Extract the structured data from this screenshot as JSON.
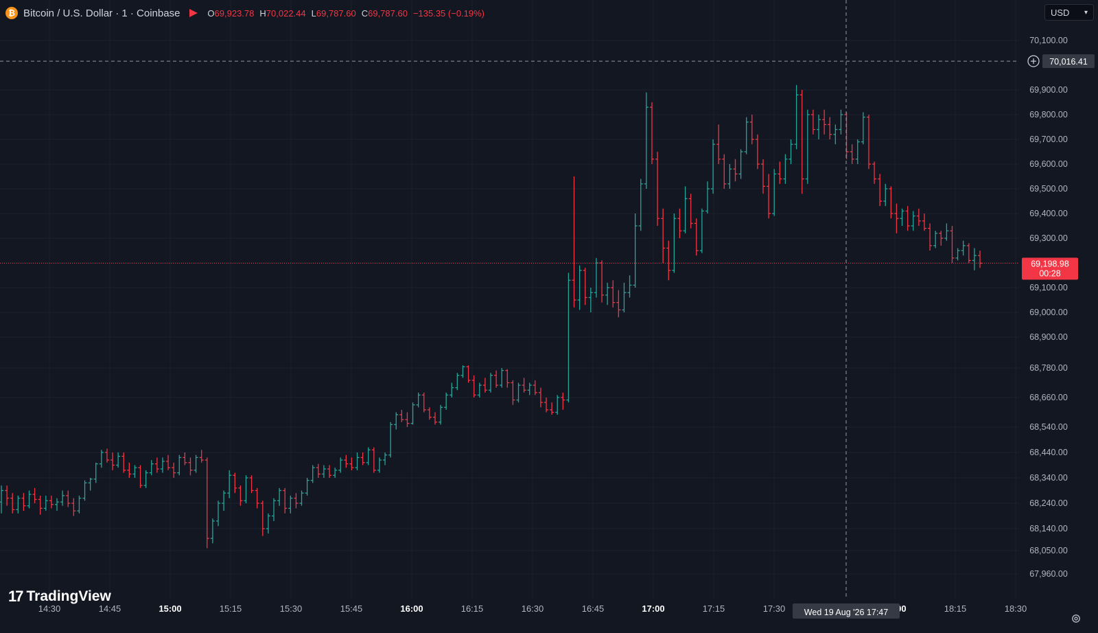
{
  "header": {
    "symbol": "Bitcoin / U.S. Dollar · 1 · Coinbase",
    "logo_letter": "₿",
    "ohlc": {
      "o_label": "O",
      "o_value": "69,923.78",
      "h_label": "H",
      "h_value": "70,022.44",
      "l_label": "L",
      "l_value": "69,787.60",
      "c_label": "C",
      "c_value": "69,787.60",
      "change": "−135.35 (−0.19%)"
    }
  },
  "currency_select": {
    "value": "USD",
    "caret": "▾"
  },
  "branding": {
    "logo_mark": "17",
    "name": "TradingView"
  },
  "icons": {
    "settings": "gear-icon",
    "crosshair_plus": "plus-circle-icon",
    "flag": "flag-icon",
    "coin": "bitcoin-icon"
  },
  "colors": {
    "background": "#131722",
    "up": "#26a69a",
    "down": "#f23645",
    "grid": "#1e222d",
    "axis_text": "#b2b5be",
    "crosshair": "#9598a1",
    "label_bg": "#363a45"
  },
  "crosshair": {
    "price_label": "70,016.41",
    "price": 70016.41,
    "time_label": "Wed 19 Aug '26   17:47",
    "time_minutes": 1067
  },
  "last_price": {
    "price": 69198.98,
    "price_label": "69,198.98",
    "countdown": "00:28"
  },
  "chart_data": {
    "type": "candlestick",
    "title": "Bitcoin / U.S. Dollar · 1 · Coinbase",
    "interval": "1",
    "exchange": "Coinbase",
    "y_ticks": [
      {
        "value": 67960,
        "label": "67,960.00"
      },
      {
        "value": 68050,
        "label": "68,050.00"
      },
      {
        "value": 68140,
        "label": "68,140.00"
      },
      {
        "value": 68240,
        "label": "68,240.00"
      },
      {
        "value": 68340,
        "label": "68,340.00"
      },
      {
        "value": 68440,
        "label": "68,440.00"
      },
      {
        "value": 68540,
        "label": "68,540.00"
      },
      {
        "value": 68660,
        "label": "68,660.00"
      },
      {
        "value": 68780,
        "label": "68,780.00"
      },
      {
        "value": 68900,
        "label": "68,900.00"
      },
      {
        "value": 69000,
        "label": "69,000.00"
      },
      {
        "value": 69100,
        "label": "69,100.00"
      },
      {
        "value": 69200,
        "label": "69,200.00"
      },
      {
        "value": 69300,
        "label": "69,300.00"
      },
      {
        "value": 69400,
        "label": "69,400.00"
      },
      {
        "value": 69500,
        "label": "69,500.00"
      },
      {
        "value": 69600,
        "label": "69,600.00"
      },
      {
        "value": 69700,
        "label": "69,700.00"
      },
      {
        "value": 69800,
        "label": "69,800.00"
      },
      {
        "value": 69900,
        "label": "69,900.00"
      },
      {
        "value": 70100,
        "label": "70,100.00"
      }
    ],
    "x_ticks": [
      {
        "label": "14:30",
        "minutes": 870,
        "bold": false
      },
      {
        "label": "14:45",
        "minutes": 885,
        "bold": false
      },
      {
        "label": "15:00",
        "minutes": 900,
        "bold": true
      },
      {
        "label": "15:15",
        "minutes": 915,
        "bold": false
      },
      {
        "label": "15:30",
        "minutes": 930,
        "bold": false
      },
      {
        "label": "15:45",
        "minutes": 945,
        "bold": false
      },
      {
        "label": "16:00",
        "minutes": 960,
        "bold": true
      },
      {
        "label": "16:15",
        "minutes": 975,
        "bold": false
      },
      {
        "label": "16:30",
        "minutes": 990,
        "bold": false
      },
      {
        "label": "16:45",
        "minutes": 1005,
        "bold": false
      },
      {
        "label": "17:00",
        "minutes": 1020,
        "bold": true
      },
      {
        "label": "17:15",
        "minutes": 1035,
        "bold": false
      },
      {
        "label": "17:30",
        "minutes": 1050,
        "bold": false
      },
      {
        "label": "18:00",
        "minutes": 1080,
        "bold": true
      },
      {
        "label": "18:15",
        "minutes": 1095,
        "bold": false
      },
      {
        "label": "18:30",
        "minutes": 1110,
        "bold": false
      }
    ],
    "ohlc_series": [
      [
        68245,
        68310,
        68200,
        68290
      ],
      [
        68290,
        68310,
        68230,
        68260
      ],
      [
        68260,
        68280,
        68200,
        68215
      ],
      [
        68215,
        68270,
        68200,
        68260
      ],
      [
        68260,
        68280,
        68210,
        68230
      ],
      [
        68230,
        68290,
        68220,
        68275
      ],
      [
        68275,
        68300,
        68240,
        68255
      ],
      [
        68255,
        68270,
        68195,
        68220
      ],
      [
        68220,
        68270,
        68210,
        68250
      ],
      [
        68250,
        68270,
        68220,
        68235
      ],
      [
        68235,
        68260,
        68210,
        68245
      ],
      [
        68245,
        68290,
        68230,
        68270
      ],
      [
        68270,
        68290,
        68225,
        68240
      ],
      [
        68240,
        68260,
        68190,
        68210
      ],
      [
        68210,
        68270,
        68200,
        68260
      ],
      [
        68260,
        68330,
        68250,
        68320
      ],
      [
        68320,
        68340,
        68290,
        68335
      ],
      [
        68335,
        68400,
        68320,
        68395
      ],
      [
        68395,
        68450,
        68380,
        68440
      ],
      [
        68440,
        68455,
        68400,
        68410
      ],
      [
        68410,
        68440,
        68370,
        68390
      ],
      [
        68390,
        68440,
        68380,
        68425
      ],
      [
        68425,
        68440,
        68360,
        68370
      ],
      [
        68370,
        68400,
        68340,
        68355
      ],
      [
        68355,
        68390,
        68340,
        68380
      ],
      [
        68380,
        68390,
        68300,
        68310
      ],
      [
        68310,
        68370,
        68300,
        68360
      ],
      [
        68360,
        68410,
        68350,
        68395
      ],
      [
        68395,
        68420,
        68360,
        68375
      ],
      [
        68375,
        68420,
        68360,
        68405
      ],
      [
        68405,
        68430,
        68370,
        68380
      ],
      [
        68380,
        68400,
        68340,
        68360
      ],
      [
        68360,
        68430,
        68350,
        68420
      ],
      [
        68420,
        68440,
        68390,
        68400
      ],
      [
        68400,
        68420,
        68350,
        68370
      ],
      [
        68370,
        68430,
        68360,
        68420
      ],
      [
        68420,
        68450,
        68400,
        68410
      ],
      [
        68410,
        68420,
        68060,
        68100
      ],
      [
        68100,
        68180,
        68080,
        68170
      ],
      [
        68170,
        68250,
        68150,
        68240
      ],
      [
        68240,
        68290,
        68210,
        68280
      ],
      [
        68280,
        68370,
        68260,
        68350
      ],
      [
        68350,
        68360,
        68280,
        68300
      ],
      [
        68300,
        68310,
        68230,
        68250
      ],
      [
        68250,
        68350,
        68240,
        68340
      ],
      [
        68340,
        68350,
        68280,
        68290
      ],
      [
        68290,
        68300,
        68220,
        68240
      ],
      [
        68240,
        68250,
        68110,
        68140
      ],
      [
        68140,
        68200,
        68120,
        68190
      ],
      [
        68190,
        68260,
        68170,
        68250
      ],
      [
        68250,
        68300,
        68230,
        68290
      ],
      [
        68290,
        68300,
        68200,
        68220
      ],
      [
        68220,
        68270,
        68200,
        68260
      ],
      [
        68260,
        68280,
        68220,
        68240
      ],
      [
        68240,
        68290,
        68230,
        68280
      ],
      [
        68280,
        68340,
        68270,
        68330
      ],
      [
        68330,
        68390,
        68320,
        68380
      ],
      [
        68380,
        68395,
        68340,
        68355
      ],
      [
        68355,
        68390,
        68340,
        68375
      ],
      [
        68375,
        68390,
        68340,
        68350
      ],
      [
        68350,
        68380,
        68340,
        68370
      ],
      [
        68370,
        68420,
        68360,
        68410
      ],
      [
        68410,
        68430,
        68380,
        68395
      ],
      [
        68395,
        68420,
        68370,
        68380
      ],
      [
        68380,
        68440,
        68370,
        68420
      ],
      [
        68420,
        68440,
        68390,
        68400
      ],
      [
        68400,
        68460,
        68390,
        68450
      ],
      [
        68450,
        68460,
        68360,
        68370
      ],
      [
        68370,
        68420,
        68360,
        68410
      ],
      [
        68410,
        68440,
        68390,
        68430
      ],
      [
        68430,
        68560,
        68420,
        68550
      ],
      [
        68550,
        68600,
        68530,
        68590
      ],
      [
        68590,
        68610,
        68560,
        68570
      ],
      [
        68570,
        68600,
        68540,
        68555
      ],
      [
        68555,
        68640,
        68550,
        68630
      ],
      [
        68630,
        68680,
        68620,
        68670
      ],
      [
        68670,
        68680,
        68600,
        68610
      ],
      [
        68610,
        68620,
        68570,
        68580
      ],
      [
        68580,
        68600,
        68550,
        68560
      ],
      [
        68560,
        68630,
        68550,
        68620
      ],
      [
        68620,
        68680,
        68610,
        68670
      ],
      [
        68670,
        68720,
        68660,
        68700
      ],
      [
        68700,
        68760,
        68690,
        68750
      ],
      [
        68750,
        68790,
        68740,
        68785
      ],
      [
        68785,
        68790,
        68720,
        68730
      ],
      [
        68730,
        68750,
        68660,
        68670
      ],
      [
        68670,
        68720,
        68660,
        68710
      ],
      [
        68710,
        68740,
        68680,
        68690
      ],
      [
        68690,
        68760,
        68680,
        68750
      ],
      [
        68750,
        68770,
        68700,
        68710
      ],
      [
        68710,
        68780,
        68700,
        68770
      ],
      [
        68770,
        68775,
        68700,
        68720
      ],
      [
        68720,
        68730,
        68630,
        68650
      ],
      [
        68650,
        68720,
        68640,
        68710
      ],
      [
        68710,
        68740,
        68680,
        68690
      ],
      [
        68690,
        68720,
        68670,
        68710
      ],
      [
        68710,
        68730,
        68670,
        68680
      ],
      [
        68680,
        68700,
        68620,
        68640
      ],
      [
        68640,
        68660,
        68600,
        68610
      ],
      [
        68610,
        68640,
        68590,
        68600
      ],
      [
        68600,
        68670,
        68590,
        68660
      ],
      [
        68660,
        68680,
        68610,
        68650
      ],
      [
        68650,
        69160,
        68640,
        69130
      ],
      [
        69130,
        69550,
        69020,
        69050
      ],
      [
        69050,
        69190,
        69010,
        69170
      ],
      [
        69170,
        69180,
        69030,
        69060
      ],
      [
        69060,
        69100,
        69000,
        69080
      ],
      [
        69080,
        69220,
        69060,
        69200
      ],
      [
        69200,
        69210,
        69040,
        69070
      ],
      [
        69070,
        69120,
        69030,
        69100
      ],
      [
        69100,
        69130,
        69020,
        69040
      ],
      [
        69040,
        69090,
        68980,
        69010
      ],
      [
        69010,
        69120,
        69000,
        69080
      ],
      [
        69080,
        69150,
        69060,
        69110
      ],
      [
        69110,
        69400,
        69100,
        69350
      ],
      [
        69350,
        69540,
        69330,
        69520
      ],
      [
        69520,
        69890,
        69500,
        69830
      ],
      [
        69830,
        69850,
        69600,
        69620
      ],
      [
        69620,
        69650,
        69350,
        69380
      ],
      [
        69380,
        69420,
        69200,
        69260
      ],
      [
        69260,
        69290,
        69130,
        69170
      ],
      [
        69170,
        69400,
        69160,
        69380
      ],
      [
        69380,
        69420,
        69300,
        69330
      ],
      [
        69330,
        69510,
        69320,
        69460
      ],
      [
        69460,
        69480,
        69340,
        69360
      ],
      [
        69360,
        69380,
        69230,
        69250
      ],
      [
        69250,
        69420,
        69240,
        69410
      ],
      [
        69410,
        69530,
        69400,
        69500
      ],
      [
        69500,
        69700,
        69480,
        69680
      ],
      [
        69680,
        69760,
        69600,
        69620
      ],
      [
        69620,
        69640,
        69500,
        69520
      ],
      [
        69520,
        69600,
        69500,
        69580
      ],
      [
        69580,
        69620,
        69530,
        69560
      ],
      [
        69560,
        69660,
        69540,
        69650
      ],
      [
        69650,
        69790,
        69640,
        69770
      ],
      [
        69770,
        69800,
        69680,
        69700
      ],
      [
        69700,
        69720,
        69580,
        69600
      ],
      [
        69600,
        69620,
        69480,
        69510
      ],
      [
        69510,
        69560,
        69380,
        69400
      ],
      [
        69400,
        69580,
        69390,
        69560
      ],
      [
        69560,
        69610,
        69520,
        69540
      ],
      [
        69540,
        69640,
        69520,
        69620
      ],
      [
        69620,
        69700,
        69600,
        69680
      ],
      [
        69680,
        69920,
        69660,
        69880
      ],
      [
        69880,
        69900,
        69480,
        69540
      ],
      [
        69540,
        69820,
        69520,
        69800
      ],
      [
        69800,
        69820,
        69720,
        69740
      ],
      [
        69740,
        69800,
        69700,
        69780
      ],
      [
        69780,
        69820,
        69720,
        69760
      ],
      [
        69760,
        69790,
        69700,
        69720
      ],
      [
        69720,
        69760,
        69680,
        69740
      ],
      [
        69740,
        69820,
        69720,
        69800
      ],
      [
        69800,
        69810,
        69620,
        69650
      ],
      [
        69650,
        69680,
        69600,
        69620
      ],
      [
        69620,
        69700,
        69600,
        69690
      ],
      [
        69690,
        69810,
        69680,
        69790
      ],
      [
        69790,
        69800,
        69580,
        69600
      ],
      [
        69600,
        69610,
        69520,
        69540
      ],
      [
        69540,
        69560,
        69430,
        69450
      ],
      [
        69450,
        69520,
        69430,
        69500
      ],
      [
        69500,
        69510,
        69380,
        69400
      ],
      [
        69400,
        69440,
        69320,
        69380
      ],
      [
        69380,
        69420,
        69350,
        69410
      ],
      [
        69410,
        69430,
        69330,
        69350
      ],
      [
        69350,
        69410,
        69330,
        69390
      ],
      [
        69390,
        69420,
        69350,
        69370
      ],
      [
        69370,
        69400,
        69330,
        69340
      ],
      [
        69340,
        69360,
        69250,
        69270
      ],
      [
        69270,
        69330,
        69260,
        69320
      ],
      [
        69320,
        69330,
        69270,
        69300
      ],
      [
        69300,
        69360,
        69290,
        69330
      ],
      [
        69330,
        69350,
        69200,
        69220
      ],
      [
        69220,
        69260,
        69210,
        69250
      ],
      [
        69250,
        69290,
        69230,
        69270
      ],
      [
        69270,
        69280,
        69200,
        69210
      ],
      [
        69210,
        69260,
        69170,
        69230
      ],
      [
        69230,
        69250,
        69180,
        69199
      ]
    ]
  }
}
